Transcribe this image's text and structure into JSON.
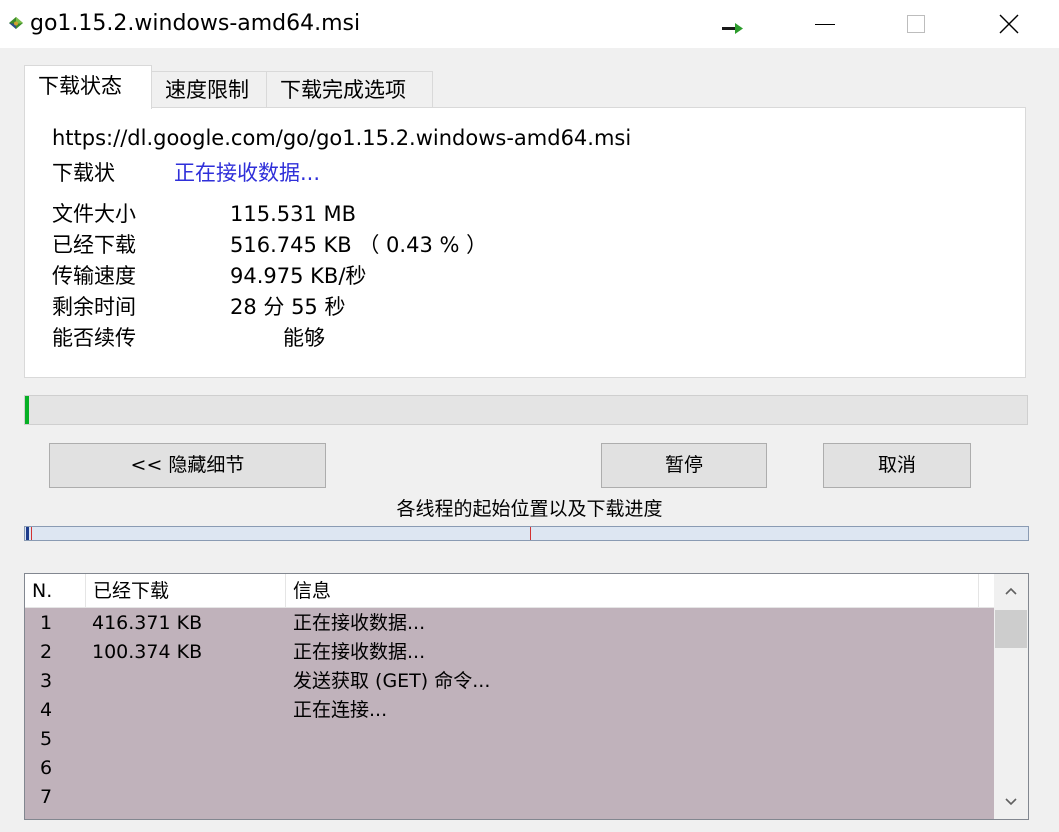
{
  "window": {
    "title": "go1.15.2.windows-amd64.msi",
    "icons": {
      "app": "download-app-icon",
      "transfer": "transfer-arrow-icon"
    }
  },
  "tabs": {
    "status": "下载状态",
    "speed_limit": "速度限制",
    "on_complete": "下载完成选项"
  },
  "status_panel": {
    "url": "https://dl.google.com/go/go1.15.2.windows-amd64.msi",
    "status_label": "下载状",
    "status_value": "正在接收数据...",
    "file_size_label": "文件大小",
    "file_size_value": "115.531  MB",
    "downloaded_label": "已经下载",
    "downloaded_value": "516.745  KB （ 0.43 % ）",
    "speed_label": "传输速度",
    "speed_value": "94.975  KB/秒",
    "remaining_label": "剩余时间",
    "remaining_value": "28 分 55 秒",
    "resume_label": "能否续传",
    "resume_value": "能够"
  },
  "overall_progress_percent": 0.43,
  "buttons": {
    "hide_details": "<< 隐藏细节",
    "pause": "暂停",
    "cancel": "取消"
  },
  "threads": {
    "label": "各线程的起始位置以及下载进度"
  },
  "connections": {
    "columns": {
      "n": "N.",
      "downloaded": "已经下载",
      "info": "信息"
    },
    "rows": [
      {
        "n": "1",
        "downloaded": "416.371  KB",
        "info": "正在接收数据..."
      },
      {
        "n": "2",
        "downloaded": "100.374  KB",
        "info": "正在接收数据..."
      },
      {
        "n": "3",
        "downloaded": "",
        "info": "发送获取 (GET) 命令..."
      },
      {
        "n": "4",
        "downloaded": "",
        "info": "正在连接..."
      },
      {
        "n": "5",
        "downloaded": "",
        "info": ""
      },
      {
        "n": "6",
        "downloaded": "",
        "info": ""
      },
      {
        "n": "7",
        "downloaded": "",
        "info": ""
      }
    ]
  },
  "colors": {
    "status_value": "#2f2fd9",
    "list_background": "#c0b2bb",
    "thread_marker": "#d23232"
  }
}
